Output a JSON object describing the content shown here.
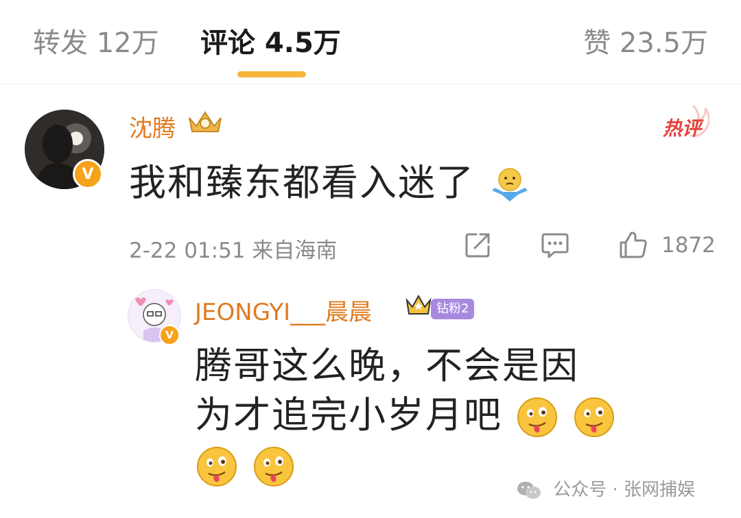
{
  "tabs": {
    "repost": "转发 12万",
    "comments": "评论 4.5万",
    "likes": "赞 23.5万"
  },
  "comment": {
    "username": "沈腾",
    "hot_tag": "热评",
    "text": "我和臻东都看入迷了",
    "emoji": "shrug-emoji",
    "timestamp": "2-22 01:51 来自海南",
    "like_count": "1872"
  },
  "reply": {
    "username": "JEONGYI___晨晨",
    "fan_badge": "钻粉2",
    "text_line1": "腾哥这么晚，不会是因",
    "text_line2": "为才追完小岁月吧",
    "emoji": "tongue-out-emoji"
  },
  "watermark": {
    "text": "公众号 · 张网捕娱"
  },
  "colors": {
    "accent_orange": "#f5b53a",
    "username_orange": "#e07a1f",
    "hot_red": "#e4423c",
    "verified": "#f7a21b"
  }
}
